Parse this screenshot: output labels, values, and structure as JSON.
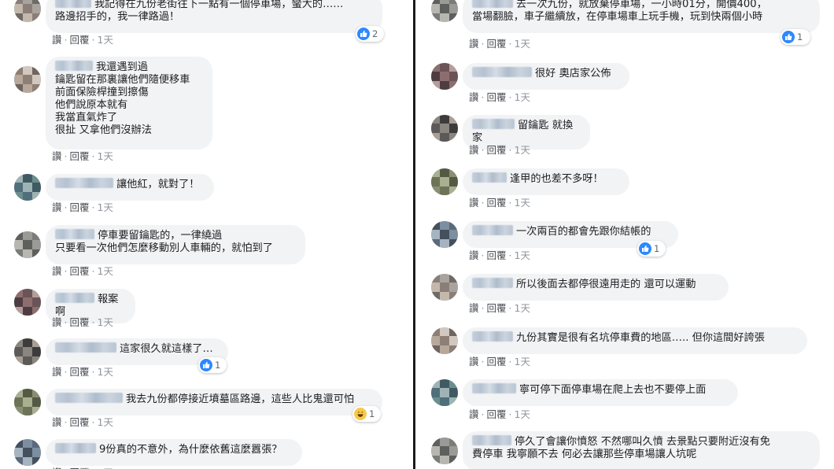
{
  "actions": {
    "like": "讚",
    "reply": "回覆",
    "time": "1天"
  },
  "left_comments": [
    {
      "text": "我記得在九份老街往下一點有一個停車場，蠻大的……\n路邊招手的，我一律路過！",
      "reaction": {
        "type": "like",
        "count": "2"
      }
    },
    {
      "text": "我還遇到過\n鑰匙留在那裏讓他們隨便移車\n前面保險桿撞到擦傷\n他們說原本就有\n我當直氣炸了\n很扯 又拿他們沒辦法",
      "reaction": null
    },
    {
      "text": "讓他紅，就對了！",
      "reaction": null
    },
    {
      "text": "停車要留鑰匙的，一律繞過\n只要看一次他們怎麼移動別人車輛的，就怕到了",
      "reaction": null
    },
    {
      "text": "報案啊",
      "reaction": null
    },
    {
      "text": "這家很久就這樣了…",
      "reaction": {
        "type": "like",
        "count": "1"
      }
    },
    {
      "text": "我去九份都停接近墳墓區路邊，這些人比鬼還可怕",
      "reaction": {
        "type": "haha",
        "count": "1"
      }
    },
    {
      "text": "9份真的不意外，為什麼依舊這麼囂張？",
      "reaction": null
    }
  ],
  "right_comments": [
    {
      "text": "去一次九份，就放棄停車場，一小時01分，開價400，\n當場翻臉，車子繼續放，在停車場車上玩手機，玩到快兩個小時",
      "reaction": {
        "type": "like",
        "count": "1"
      }
    },
    {
      "text": "很好 奧店家公佈",
      "reaction": null
    },
    {
      "text": "留鑰匙 就換家",
      "reaction": null
    },
    {
      "text": "逢甲的也差不多呀！",
      "reaction": null
    },
    {
      "text": "一次兩百的都會先跟你結帳的",
      "reaction": {
        "type": "like",
        "count": "1"
      }
    },
    {
      "text": "所以後面去都停很遠用走的 還可以運動",
      "reaction": null
    },
    {
      "text": "九份其實是很有名坑停車費的地區….. 但你這間好誇張",
      "reaction": null
    },
    {
      "text": "寧可停下面停車場在爬上去也不要停上面",
      "reaction": null
    },
    {
      "text": "停久了會讓你憤怒 不然哪叫久憤 去景點只要附近沒有免\n費停車 我寧願不去 何必去讓那些停車場讓人坑呢",
      "reaction": null
    }
  ],
  "colors": {
    "bubble": "#f2f3f5",
    "like": "#2d88ff",
    "haha": "#f7c94a",
    "action": "#4b4f56",
    "divider": "#1a1a1a"
  }
}
